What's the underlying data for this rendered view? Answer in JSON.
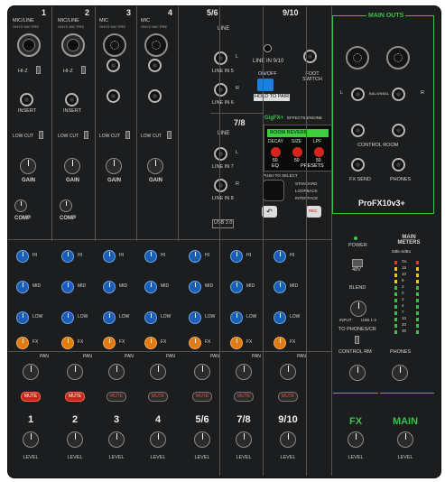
{
  "channels": [
    {
      "num": "1",
      "type": "MIC/LINE",
      "sub": "ONYX MIC PRE",
      "inst": "HI-Z",
      "insert": "INSERT",
      "lowcut": "LOW CUT",
      "gain": "GAIN",
      "comp": "COMP",
      "hi": "HI",
      "mid": "MID",
      "low": "LOW",
      "fx": "FX",
      "pan": "PAN",
      "mute": "MUTE",
      "level": "LEVEL",
      "mute_on": true
    },
    {
      "num": "2",
      "type": "MIC/LINE",
      "sub": "ONYX MIC PRE",
      "inst": "HI-Z",
      "insert": "INSERT",
      "lowcut": "LOW CUT",
      "gain": "GAIN",
      "comp": "COMP",
      "hi": "HI",
      "mid": "MID",
      "low": "LOW",
      "fx": "FX",
      "pan": "PAN",
      "mute": "MUTE",
      "level": "LEVEL",
      "mute_on": true
    },
    {
      "num": "3",
      "type": "MIC",
      "sub": "ONYX MIC PRE",
      "inst": "",
      "insert": "",
      "lowcut": "LOW CUT",
      "gain": "GAIN",
      "comp": "",
      "hi": "HI",
      "mid": "MID",
      "low": "LOW",
      "fx": "FX",
      "pan": "PAN",
      "mute": "MUTE",
      "level": "LEVEL",
      "mute_on": false
    },
    {
      "num": "4",
      "type": "MIC",
      "sub": "ONYX MIC PRE",
      "inst": "",
      "insert": "",
      "lowcut": "LOW CUT",
      "gain": "GAIN",
      "comp": "",
      "hi": "HI",
      "mid": "MID",
      "low": "LOW",
      "fx": "FX",
      "pan": "PAN",
      "mute": "MUTE",
      "level": "LEVEL",
      "mute_on": false
    },
    {
      "num": "5/6",
      "type": "LINE",
      "sub": "",
      "inst": "",
      "insert": "",
      "lowcut": "",
      "gain": "",
      "comp": "",
      "hi": "HI",
      "mid": "MID",
      "low": "LOW",
      "fx": "FX",
      "pan": "PAN",
      "mute": "MUTE",
      "level": "LEVEL",
      "mute_on": false
    },
    {
      "num": "7/8",
      "type": "LINE",
      "sub": "",
      "inst": "",
      "insert": "",
      "lowcut": "",
      "gain": "",
      "comp": "",
      "hi": "HI",
      "mid": "MID",
      "low": "LOW",
      "fx": "FX",
      "pan": "PAN",
      "mute": "MUTE",
      "level": "LEVEL",
      "mute_on": false
    },
    {
      "num": "9/10",
      "type": "LINE",
      "sub": "",
      "inst": "",
      "insert": "",
      "lowcut": "",
      "gain": "",
      "comp": "",
      "hi": "HI",
      "mid": "MID",
      "low": "LOW",
      "fx": "FX",
      "pan": "PAN",
      "mute": "MUTE",
      "level": "LEVEL",
      "mute_on": false
    }
  ],
  "line_in_56": {
    "title": "LINE",
    "l": "LINE IN 5",
    "r": "LINE IN 6",
    "ltag": "L",
    "rtag": "R"
  },
  "line_in_78": {
    "title": "LINE",
    "l": "LINE IN 7",
    "r": "LINE IN 8",
    "ltag": "L",
    "rtag": "R"
  },
  "ch910": {
    "title": "9/10",
    "line": "LINE IN 9/10",
    "onoff": "ON/OFF",
    "bt": "HOLD TO PAIR",
    "foot": "FOOT SWITCH"
  },
  "fx_unit": {
    "header": "GigFX+",
    "sub": "EFFECTS ENGINE",
    "preset": "ROOM REVERB",
    "p1": "DECAY",
    "p2": "SIZE",
    "p3": "LPF",
    "v1": "50",
    "v2": "50",
    "v3": "50",
    "eq": "EQ",
    "presets": "PRESETS",
    "push": "PUSH TO SELECT",
    "std": "STANDARD",
    "loop": "LOOPBACK",
    "iface": "INTERFACE",
    "rec": "REC",
    "usb": "USB 2.0"
  },
  "main_outs": {
    "title": "MAIN OUTS",
    "l": "L",
    "r": "R",
    "bal": "BAL/UNBAL",
    "cr": "CONTROL ROOM",
    "fxsend": "FX SEND",
    "phones": "PHONES"
  },
  "right": {
    "brand": "ProFX10v3+",
    "power": "POWER",
    "v48": "48V",
    "blend": "BLEND",
    "blend_l": "INPUT",
    "blend_r": "USB 1-2",
    "to_phones": "TO PHONES/CR",
    "crm": "CONTROL RM",
    "phones": "PHONES",
    "fx": "FX",
    "main": "MAIN",
    "fx_level": "LEVEL",
    "main_level": "LEVEL"
  },
  "meters": {
    "title": "MAIN METERS",
    "sub": "0dB=0dBu",
    "scale": [
      "OL",
      "15",
      "10",
      "6",
      "3",
      "0",
      "2",
      "4",
      "7",
      "10",
      "20",
      "30"
    ]
  },
  "colors": {
    "panel": "#1b1d1e",
    "green": "#39c24a",
    "blue": "#1b5fb4",
    "orange": "#e07a12",
    "mute": "#c22a1a"
  }
}
